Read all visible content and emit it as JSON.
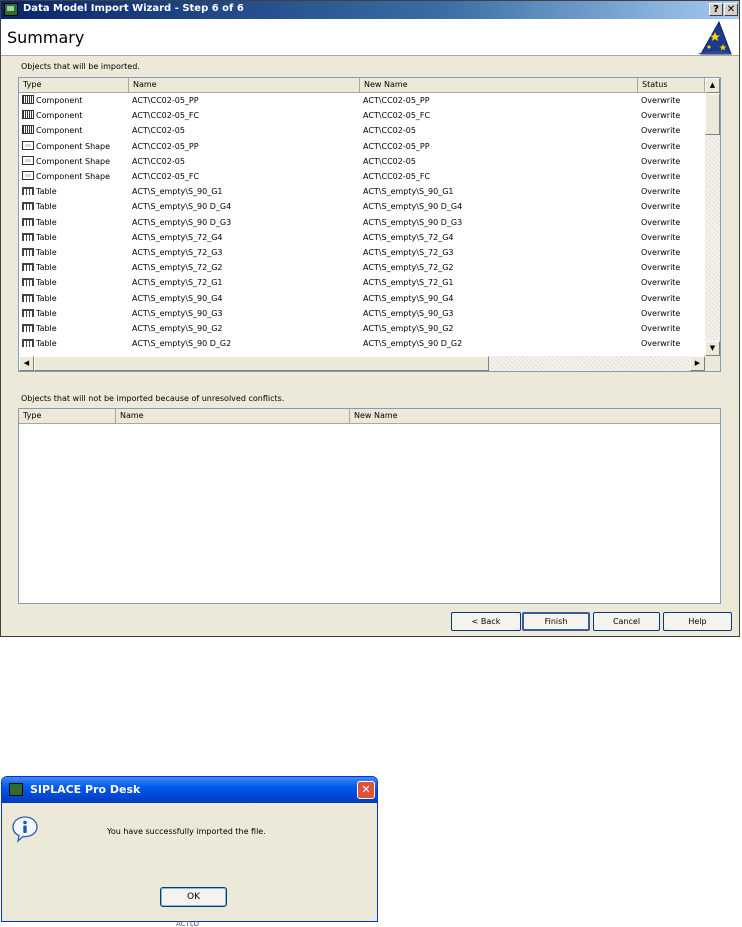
{
  "wizard": {
    "title": "Data Model Import Wizard - Step 6 of 6",
    "help_glyph": "?",
    "close_glyph": "✕",
    "heading": "Summary"
  },
  "imported": {
    "label": "Objects that will be imported.",
    "columns": [
      "Type",
      "Name",
      "New Name",
      "Status"
    ],
    "rows": [
      {
        "icon": "component",
        "type": "Component",
        "name": "ACT\\CC02-05_PP",
        "new_name": "ACT\\CC02-05_PP",
        "status": "Overwrite"
      },
      {
        "icon": "component",
        "type": "Component",
        "name": "ACT\\CC02-05_FC",
        "new_name": "ACT\\CC02-05_FC",
        "status": "Overwrite"
      },
      {
        "icon": "component",
        "type": "Component",
        "name": "ACT\\CC02-05",
        "new_name": "ACT\\CC02-05",
        "status": "Overwrite"
      },
      {
        "icon": "shape",
        "type": "Component Shape",
        "name": "ACT\\CC02-05_PP",
        "new_name": "ACT\\CC02-05_PP",
        "status": "Overwrite"
      },
      {
        "icon": "shape",
        "type": "Component Shape",
        "name": "ACT\\CC02-05",
        "new_name": "ACT\\CC02-05",
        "status": "Overwrite"
      },
      {
        "icon": "shape",
        "type": "Component Shape",
        "name": "ACT\\CC02-05_FC",
        "new_name": "ACT\\CC02-05_FC",
        "status": "Overwrite"
      },
      {
        "icon": "table",
        "type": "Table",
        "name": "ACT\\S_empty\\S_90_G1",
        "new_name": "ACT\\S_empty\\S_90_G1",
        "status": "Overwrite"
      },
      {
        "icon": "table",
        "type": "Table",
        "name": "ACT\\S_empty\\S_90 D_G4",
        "new_name": "ACT\\S_empty\\S_90 D_G4",
        "status": "Overwrite"
      },
      {
        "icon": "table",
        "type": "Table",
        "name": "ACT\\S_empty\\S_90 D_G3",
        "new_name": "ACT\\S_empty\\S_90 D_G3",
        "status": "Overwrite"
      },
      {
        "icon": "table",
        "type": "Table",
        "name": "ACT\\S_empty\\S_72_G4",
        "new_name": "ACT\\S_empty\\S_72_G4",
        "status": "Overwrite"
      },
      {
        "icon": "table",
        "type": "Table",
        "name": "ACT\\S_empty\\S_72_G3",
        "new_name": "ACT\\S_empty\\S_72_G3",
        "status": "Overwrite"
      },
      {
        "icon": "table",
        "type": "Table",
        "name": "ACT\\S_empty\\S_72_G2",
        "new_name": "ACT\\S_empty\\S_72_G2",
        "status": "Overwrite"
      },
      {
        "icon": "table",
        "type": "Table",
        "name": "ACT\\S_empty\\S_72_G1",
        "new_name": "ACT\\S_empty\\S_72_G1",
        "status": "Overwrite"
      },
      {
        "icon": "table",
        "type": "Table",
        "name": "ACT\\S_empty\\S_90_G4",
        "new_name": "ACT\\S_empty\\S_90_G4",
        "status": "Overwrite"
      },
      {
        "icon": "table",
        "type": "Table",
        "name": "ACT\\S_empty\\S_90_G3",
        "new_name": "ACT\\S_empty\\S_90_G3",
        "status": "Overwrite"
      },
      {
        "icon": "table",
        "type": "Table",
        "name": "ACT\\S_empty\\S_90_G2",
        "new_name": "ACT\\S_empty\\S_90_G2",
        "status": "Overwrite"
      },
      {
        "icon": "table",
        "type": "Table",
        "name": "ACT\\S_empty\\S_90 D_G2",
        "new_name": "ACT\\S_empty\\S_90 D_G2",
        "status": "Overwrite"
      }
    ]
  },
  "conflicts": {
    "label": "Objects that will not be imported because of unresolved conflicts.",
    "columns": [
      "Type",
      "Name",
      "New Name"
    ]
  },
  "scroll": {
    "up": "▲",
    "down": "▼",
    "left": "◀",
    "right": "▶"
  },
  "buttons": {
    "back": "< Back",
    "finish": "Finish",
    "cancel": "Cancel",
    "help": "Help"
  },
  "message": {
    "title": "SIPLACE Pro Desk",
    "close_glyph": "✕",
    "text": "You have successfully imported the file.",
    "ok": "OK"
  },
  "cutoff_text": "ACTLO"
}
